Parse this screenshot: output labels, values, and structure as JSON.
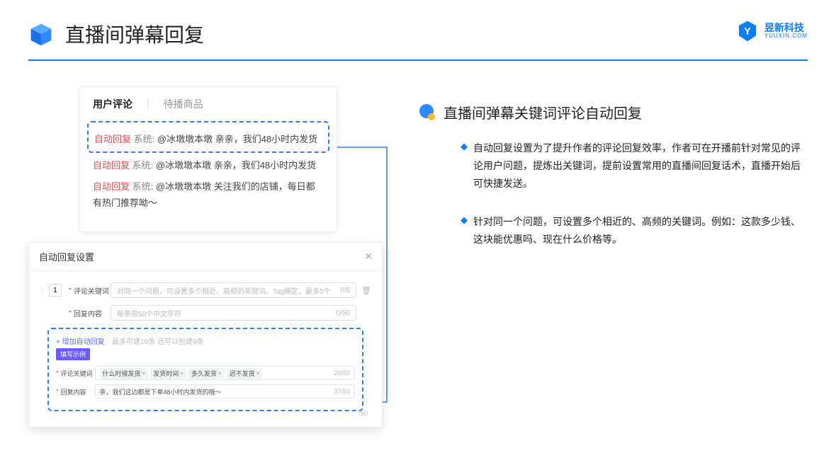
{
  "header": {
    "title": "直播间弹幕回复"
  },
  "brand": {
    "name": "昱新科技",
    "sub": "YUUXIN.COM"
  },
  "commentCard": {
    "tabActive": "用户评论",
    "tabOther": "待播商品",
    "rows": [
      {
        "tag": "自动回复",
        "sys": "系统:",
        "text": "@冰墩墩本墩 亲亲，我们48小时内发货"
      },
      {
        "tag": "自动回复",
        "sys": "系统:",
        "text": "@冰墩墩本墩 亲亲，我们48小时内发货"
      },
      {
        "tag": "自动回复",
        "sys": "系统:",
        "text": "@冰墩墩本墩 关注我们的店铺，每日都有热门推荐呦～"
      }
    ]
  },
  "settings": {
    "title": "自动回复设置",
    "idx": "1",
    "keywordLabel": "评论关键词",
    "keywordPlaceholder": "对同一个问题，可设置多个相近、高频的关键词。Tag确定，最多5个",
    "keywordCount": "0/5",
    "contentLabel": "回复内容",
    "contentPlaceholder": "每条限50个中文字符",
    "contentCount": "0/50",
    "addLabel": "+ 增加自动回复",
    "addHint": "最多可建10条 还可以创建9条",
    "exampleBadge": "填写示例",
    "exKeywordLabel": "评论关键词",
    "exTags": [
      "什么时候发货",
      "发货时间",
      "多久发货",
      "迟不发货"
    ],
    "exKeywordCount": "20/50",
    "exContentLabel": "回复内容",
    "exContentText": "亲，我们这边都是下单48小时内发货的哦～",
    "exContentCount": "37/50",
    "outsideCount": "/50"
  },
  "section": {
    "title": "直播间弹幕关键词评论自动回复",
    "bullets": [
      "自动回复设置为了提升作者的评论回复效率，作者可在开播前针对常见的评论用户问题，提炼出关键词，提前设置常用的直播间回复话术，直播开始后可快捷发送。",
      "针对同一个问题，可设置多个相近的、高频的关键词。例如：这款多少钱、这块能优惠吗、现在什么价格等。"
    ]
  }
}
